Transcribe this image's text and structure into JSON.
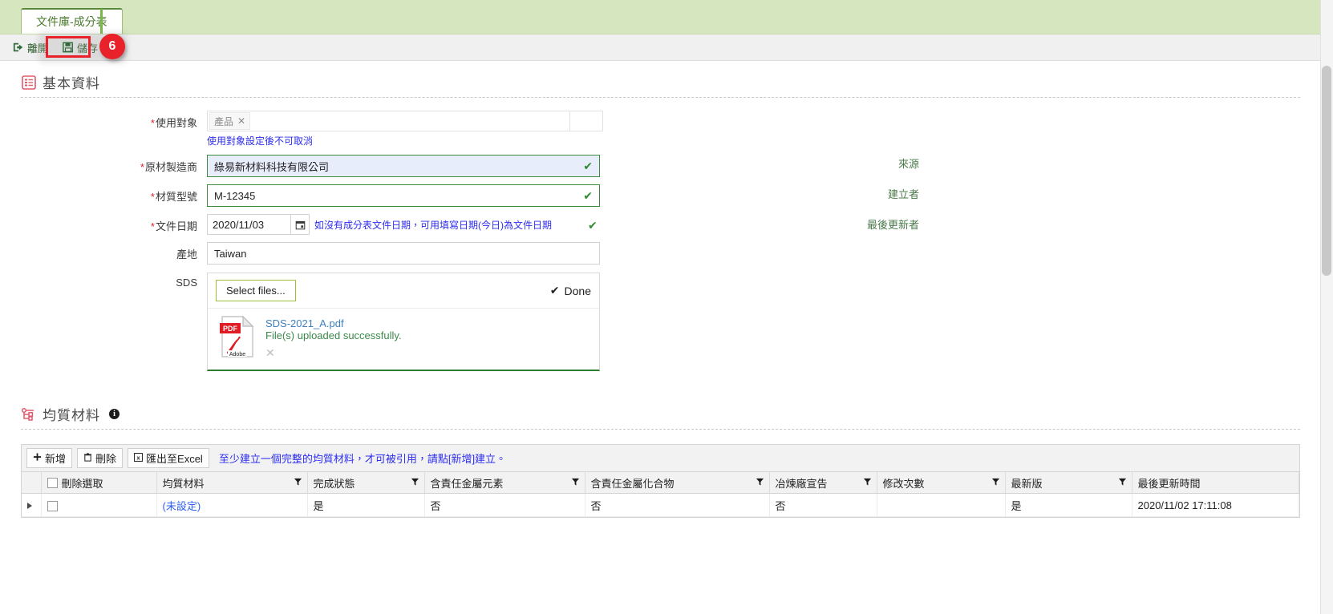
{
  "tab": {
    "label": "文件庫-成分表"
  },
  "toolbar": {
    "exit_label": "離開",
    "save_label": "儲存",
    "step_number": "6"
  },
  "basic_section": {
    "title": "基本資料",
    "icon": "list-icon"
  },
  "form": {
    "target": {
      "label": "使用對象",
      "required": true,
      "chip": "產品",
      "chip_remove": "✕",
      "hint": "使用對象設定後不可取消"
    },
    "manufacturer": {
      "label": "原材製造商",
      "required": true,
      "value": "綠易新材料科技有限公司",
      "valid_mark": "✔"
    },
    "model": {
      "label": "材質型號",
      "required": true,
      "value": "M-12345",
      "valid_mark": "✔"
    },
    "doc_date": {
      "label": "文件日期",
      "required": true,
      "value": "2020/11/03",
      "hint": "如沒有成分表文件日期，可用填寫日期(今日)為文件日期",
      "valid_mark": "✔"
    },
    "origin": {
      "label": "產地",
      "required": false,
      "value": "Taiwan"
    },
    "sds": {
      "label": "SDS",
      "select_files_label": "Select files...",
      "done_label": "Done",
      "done_mark": "✔",
      "file_name": "SDS-2021_A.pdf",
      "file_status": "File(s) uploaded successfully.",
      "file_remove": "✕",
      "pdf_badge": "PDF",
      "pdf_brand": "Adobe"
    },
    "right_labels": [
      "來源",
      "建立者",
      "最後更新者"
    ]
  },
  "material_section": {
    "title": "均質材料",
    "info_mark": "i",
    "icon": "tree-icon"
  },
  "grid": {
    "buttons": [
      {
        "label": "新增",
        "icon": "plus-icon"
      },
      {
        "label": "刪除",
        "icon": "trash-icon"
      },
      {
        "label": "匯出至Excel",
        "icon": "excel-icon"
      }
    ],
    "note": "至少建立一個完整的均質材料，才可被引用，請點[新增]建立。",
    "columns": [
      "刪除選取",
      "均質材料",
      "完成狀態",
      "含責任金屬元素",
      "含責任金屬化合物",
      "冶煉廠宣告",
      "修改次數",
      "最新版",
      "最後更新時間"
    ],
    "rows": [
      {
        "checked": false,
        "material": "(未設定)",
        "status": "是",
        "metal_element": "否",
        "metal_compound": "否",
        "smelter_declare": "否",
        "revisions": "",
        "latest": "是",
        "updated": "2020/11/02 17:11:08"
      }
    ]
  },
  "colors": {
    "tab_bar": "#d6e7bf",
    "accent_green": "#7ab648",
    "badge_red": "#e8212a",
    "link_blue": "#2d2df0",
    "valid_green": "#2e8b2e"
  }
}
